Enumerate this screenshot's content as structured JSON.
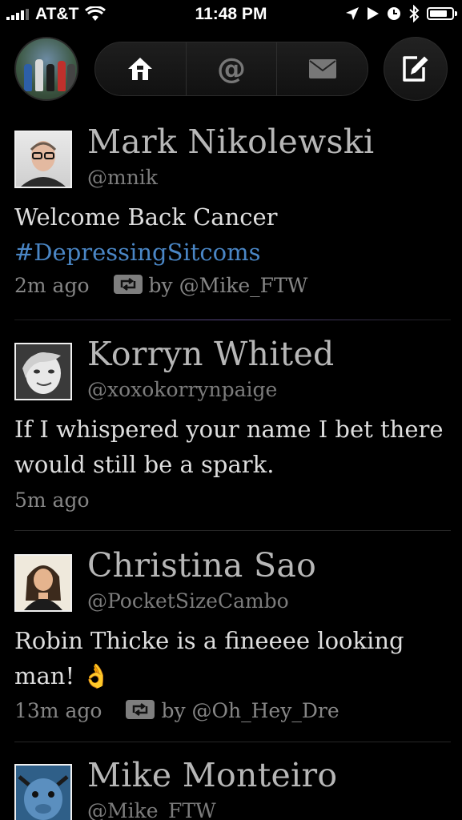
{
  "status_bar": {
    "carrier": "AT&T",
    "time": "11:48 PM",
    "battery_level": 0.8
  },
  "toolbar": {
    "tabs": [
      {
        "name": "home",
        "icon": "home-icon",
        "selected": true
      },
      {
        "name": "mentions",
        "icon": "at-icon",
        "glyph": "@"
      },
      {
        "name": "messages",
        "icon": "mail-icon"
      }
    ],
    "compose_icon": "compose-icon"
  },
  "tweets": [
    {
      "name": "Mark Nikolewski",
      "handle": "@mnik",
      "text_plain": "Welcome Back Cancer",
      "hashtag": "#DepressingSitcoms",
      "time": "2m ago",
      "retweeted_by": "by @Mike_FTW"
    },
    {
      "name": "Korryn Whited",
      "handle": "@xoxokorrynpaige",
      "text": "If I whispered your name I bet there would still be a spark.",
      "time": "5m ago"
    },
    {
      "name": "Christina Sao",
      "handle": "@PocketSizeCambo",
      "text": "Robin Thicke is a fineeee looking man! 👌",
      "time": "13m ago",
      "retweeted_by": "by @Oh_Hey_Dre"
    },
    {
      "name": "Mike Monteiro",
      "handle": "@Mike_FTW"
    }
  ],
  "colors": {
    "background": "#000000",
    "name": "#b7b7b7",
    "handle": "#7c7c7c",
    "body_text": "#dedede",
    "hashtag": "#4a86c5"
  }
}
